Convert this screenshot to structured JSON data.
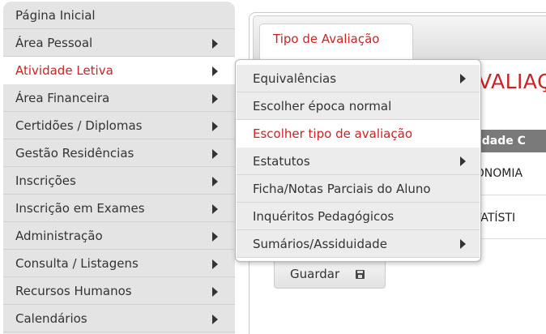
{
  "sidebar": {
    "items": [
      {
        "label": "Página Inicial",
        "has_submenu": false
      },
      {
        "label": "Área Pessoal",
        "has_submenu": true
      },
      {
        "label": "Atividade Letiva",
        "has_submenu": true,
        "active": true
      },
      {
        "label": "Área Financeira",
        "has_submenu": true
      },
      {
        "label": "Certidões / Diplomas",
        "has_submenu": true
      },
      {
        "label": "Gestão Residências",
        "has_submenu": true
      },
      {
        "label": "Inscrições",
        "has_submenu": true
      },
      {
        "label": "Inscrição em Exames",
        "has_submenu": true
      },
      {
        "label": "Administração",
        "has_submenu": true
      },
      {
        "label": "Consulta / Listagens",
        "has_submenu": true
      },
      {
        "label": "Recursos Humanos",
        "has_submenu": true
      },
      {
        "label": "Calendários",
        "has_submenu": true
      }
    ]
  },
  "submenu": {
    "items": [
      {
        "label": "Equivalências",
        "has_submenu": true
      },
      {
        "label": "Escolher época normal",
        "has_submenu": false
      },
      {
        "label": "Escolher tipo de avaliação",
        "has_submenu": false,
        "active": true
      },
      {
        "label": "Estatutos",
        "has_submenu": true
      },
      {
        "label": "Ficha/Notas Parciais do Aluno",
        "has_submenu": false
      },
      {
        "label": "Inquéritos Pedagógicos",
        "has_submenu": false
      },
      {
        "label": "Sumários/Assiduidade",
        "has_submenu": true
      }
    ]
  },
  "content": {
    "tab_label": "Tipo de Avaliação",
    "heading": "VALIAÇ",
    "table_header": "nidade C",
    "rows": [
      "CONOMIA",
      "STATÍSTI"
    ],
    "save_label": "Guardar",
    "save_icon": "floppy-disk-icon"
  },
  "colors": {
    "accent": "#cc2222",
    "menu_bg": "#e4e4e4",
    "submenu_bg": "#ececec",
    "header_bg": "#7a7a7a"
  }
}
